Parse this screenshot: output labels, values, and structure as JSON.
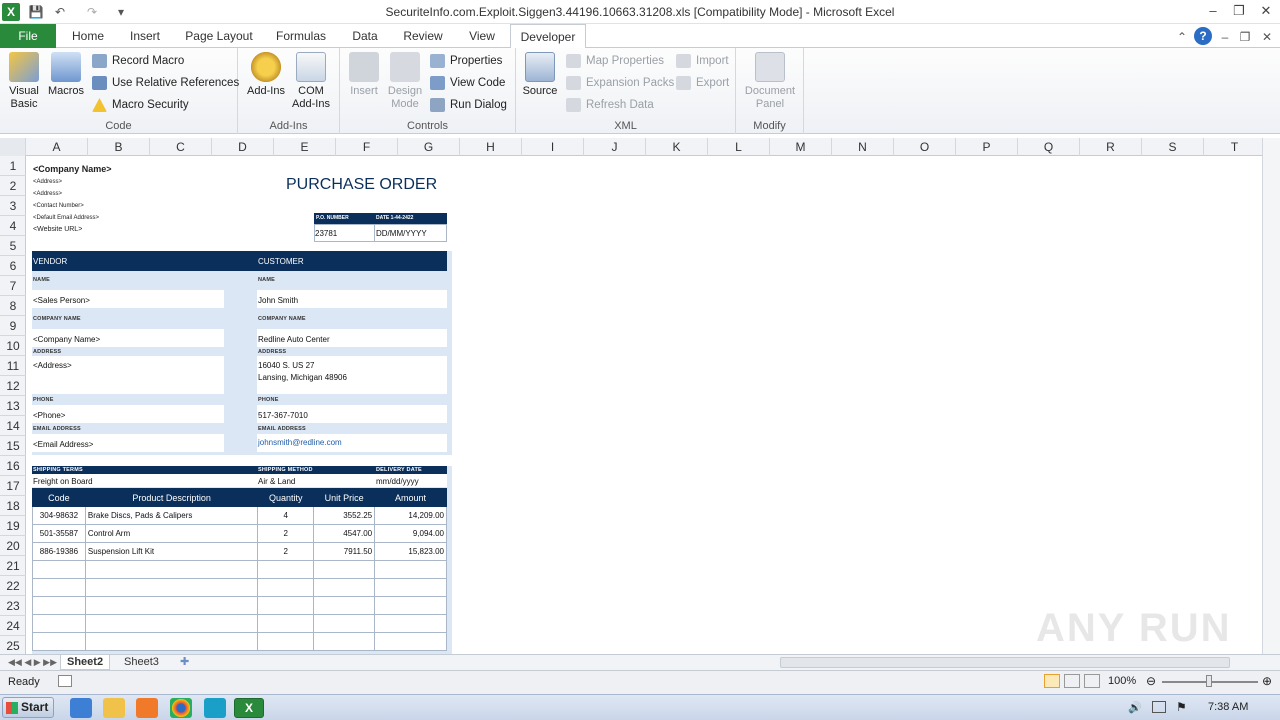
{
  "window": {
    "title": "SecuriteInfo.com.Exploit.Siggen3.44196.10663.31208.xls  [Compatibility Mode]  -  Microsoft Excel"
  },
  "tabs": [
    "File",
    "Home",
    "Insert",
    "Page Layout",
    "Formulas",
    "Data",
    "Review",
    "View",
    "Developer"
  ],
  "active_tab": "Developer",
  "ribbon": {
    "code": {
      "label": "Code",
      "visual_basic": "Visual\nBasic",
      "macros": "Macros",
      "record_macro": "Record Macro",
      "relative_refs": "Use Relative References",
      "macro_security": "Macro Security"
    },
    "addins": {
      "label": "Add-Ins",
      "addins": "Add-Ins",
      "com_addins": "COM\nAdd-Ins"
    },
    "controls": {
      "label": "Controls",
      "insert": "Insert",
      "design_mode": "Design\nMode",
      "properties": "Properties",
      "view_code": "View Code",
      "run_dialog": "Run Dialog"
    },
    "xml": {
      "label": "XML",
      "source": "Source",
      "map_properties": "Map Properties",
      "expansion_packs": "Expansion Packs",
      "refresh_data": "Refresh Data",
      "import": "Import",
      "export": "Export"
    },
    "modify": {
      "label": "Modify",
      "document_panel": "Document\nPanel"
    }
  },
  "columns": [
    "A",
    "B",
    "C",
    "D",
    "E",
    "F",
    "G",
    "H",
    "I",
    "J",
    "K",
    "L",
    "M",
    "N",
    "O",
    "P",
    "Q",
    "R",
    "S",
    "T"
  ],
  "rows": [
    "1",
    "2",
    "3",
    "4",
    "5",
    "6",
    "7",
    "8",
    "9",
    "10",
    "11",
    "12",
    "13",
    "14",
    "15",
    "16",
    "17",
    "18",
    "19",
    "20",
    "21",
    "22",
    "23",
    "24",
    "25"
  ],
  "po": {
    "company_name": "<Company Name>",
    "address1": "<Address>",
    "address2": "<Address>",
    "contact_number": "<Contact Number>",
    "default_email": "<Default Email Address>",
    "website": "<Website URL>",
    "title": "PURCHASE ORDER",
    "po_number_label": "P.O. NUMBER",
    "date_label": "DATE 1-44-2422",
    "po_number": "23781",
    "date": "DD/MM/YYYY",
    "vendor_header": "VENDOR",
    "customer_header": "CUSTOMER",
    "name_label": "NAME",
    "company_label": "COMPANY NAME",
    "address_label": "ADDRESS",
    "phone_label": "PHONE",
    "email_label": "EMAIL ADDRESS",
    "vendor": {
      "name": "<Sales Person>",
      "company": "<Company Name>",
      "address": "<Address>",
      "phone": "<Phone>",
      "email": "<Email Address>"
    },
    "customer": {
      "name": "John Smith",
      "company": "Redline Auto Center",
      "address1": "16040 S. US 27",
      "address2": "Lansing, Michigan 48906",
      "phone": "517-367-7010",
      "email": "johnsmith@redline.com"
    },
    "shipping_terms_label": "SHIPPING TERMS",
    "shipping_method_label": "SHIPPING METHOD",
    "delivery_date_label": "DELIVERY DATE",
    "shipping_terms": "Freight on Board",
    "shipping_method": "Air & Land",
    "delivery_date": "mm/dd/yyyy",
    "table_headers": [
      "Code",
      "Product Description",
      "Quantity",
      "Unit Price",
      "Amount"
    ],
    "items": [
      {
        "code": "304-98632",
        "desc": "Brake Discs, Pads & Calipers",
        "qty": "4",
        "price": "3552.25",
        "amount": "14,209.00"
      },
      {
        "code": "501-35587",
        "desc": "Control Arm",
        "qty": "2",
        "price": "4547.00",
        "amount": "9,094.00"
      },
      {
        "code": "886-19386",
        "desc": "Suspension Lift Kit",
        "qty": "2",
        "price": "7911.50",
        "amount": "15,823.00"
      }
    ]
  },
  "sheets": [
    "Sheet2",
    "Sheet3"
  ],
  "active_sheet": "Sheet2",
  "status": {
    "ready": "Ready",
    "zoom": "100%"
  },
  "taskbar": {
    "start": "Start",
    "clock": "7:38 AM"
  },
  "watermark": "ANY RUN"
}
